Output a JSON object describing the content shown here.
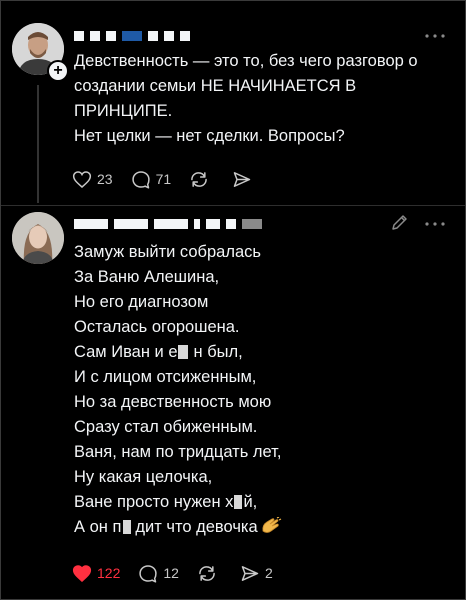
{
  "post1": {
    "text_lines": [
      "Девственность — это то, без чего разговор о",
      "создании семьи НЕ НАЧИНАЕТСЯ В",
      "ПРИНЦИПЕ.",
      "Нет целки — нет сделки. Вопросы?"
    ],
    "likes": "23",
    "replies": "71",
    "reposts": "",
    "shares": ""
  },
  "post2": {
    "text_lines": [
      "Замуж выйти собралась",
      "За Ваню Алешина,",
      "Но его диагнозом",
      "Осталась огорошена.",
      "Сам Иван и е",
      "н был,",
      "И с лицом отсиженным,",
      "Но за девственность мою",
      "Сразу стал обиженным.",
      "Ваня, нам по тридцать лет,",
      "Ну какая целочка,",
      "Ване просто нужен х",
      "й,",
      "А он п",
      "дит что девочка"
    ],
    "likes": "122",
    "replies": "12",
    "reposts": "",
    "shares": "2"
  },
  "colors": {
    "background": "#000000",
    "text": "#f3f5f7",
    "muted": "#8a8a8a",
    "like_active": "#ff3040",
    "redact_blue": "#1f5aa6"
  },
  "icons": {
    "like": "heart-icon",
    "reply": "comment-icon",
    "repost": "repost-icon",
    "share": "send-icon",
    "more": "more-icon",
    "edit": "pencil-icon",
    "follow": "plus-icon"
  }
}
